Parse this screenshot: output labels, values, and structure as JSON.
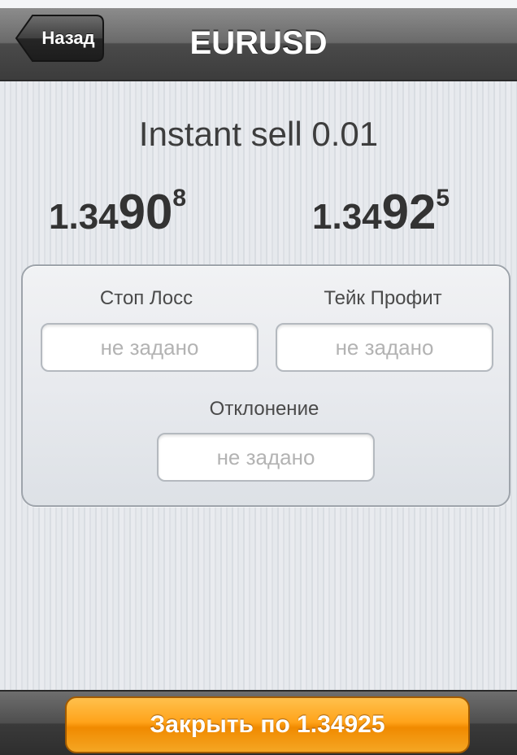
{
  "navbar": {
    "back_label": "Назад",
    "title": "EURUSD"
  },
  "order": {
    "title": "Instant sell 0.01"
  },
  "prices": {
    "bid": {
      "value": "1.34908",
      "prefix": "1.34",
      "big": "90",
      "pip": "8"
    },
    "ask": {
      "value": "1.34925",
      "prefix": "1.34",
      "big": "92",
      "pip": "5"
    }
  },
  "fields": {
    "stop_loss": {
      "label": "Стоп Лосс",
      "placeholder": "не задано",
      "value": ""
    },
    "take_profit": {
      "label": "Тейк Профит",
      "placeholder": "не задано",
      "value": ""
    },
    "deviation": {
      "label": "Отклонение",
      "placeholder": "не задано",
      "value": ""
    }
  },
  "action": {
    "close_label": "Закрыть по 1.34925"
  },
  "colors": {
    "navbar": "#3c3c3c",
    "accent_button": "#ffa31a",
    "text_dark": "#333333",
    "placeholder": "#b3b3b3"
  }
}
